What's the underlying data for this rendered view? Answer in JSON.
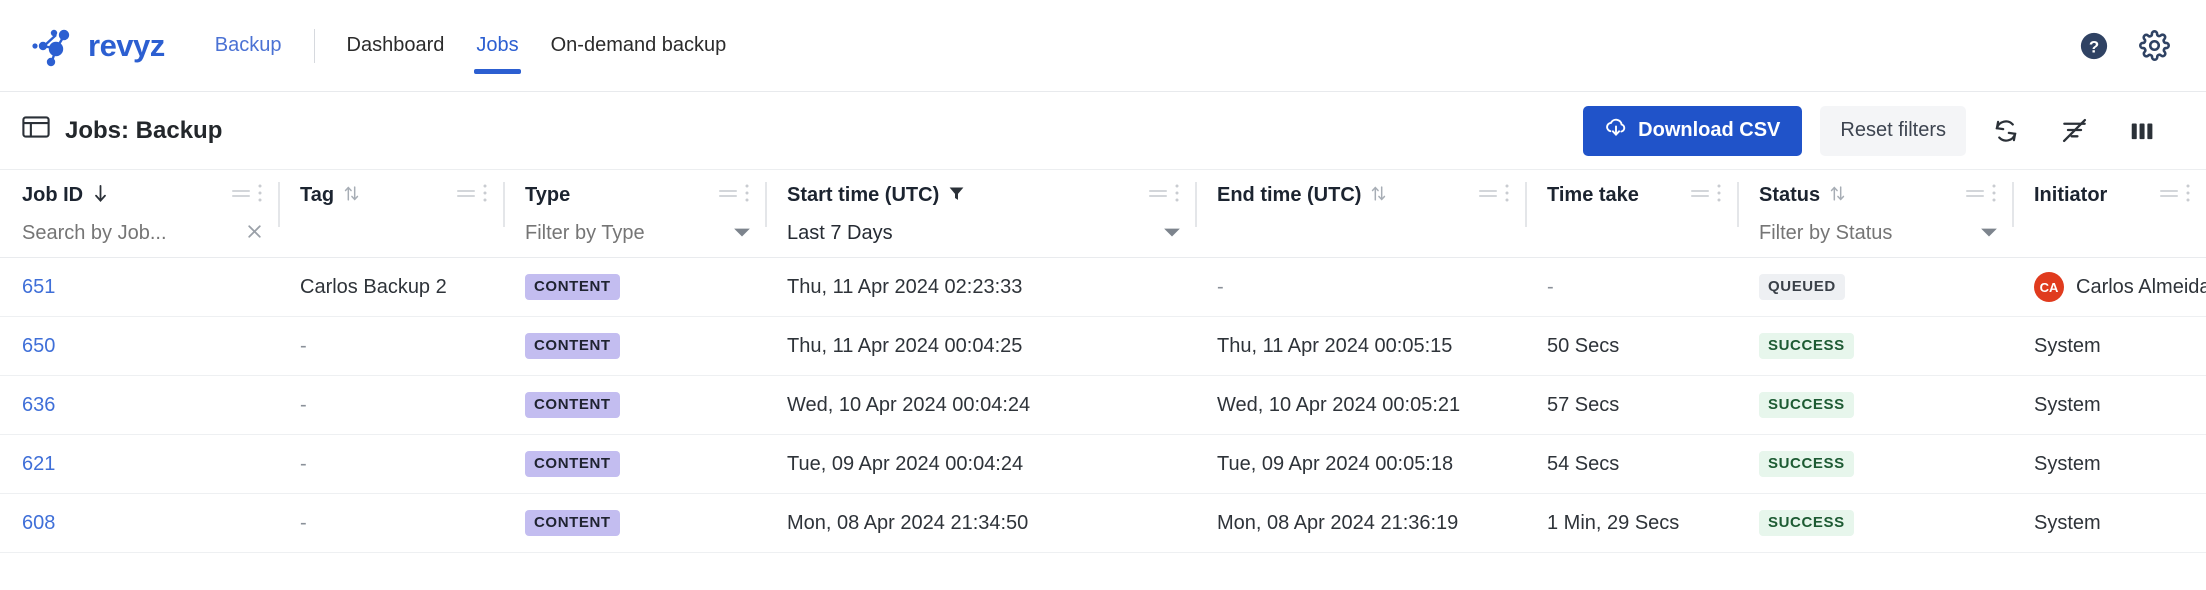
{
  "brand": {
    "name": "revyz",
    "logo_icon": "molecule-node-icon",
    "color": "#2c5fd1"
  },
  "nav": {
    "product_label": "Backup",
    "links": [
      {
        "label": "Dashboard",
        "active": false
      },
      {
        "label": "Jobs",
        "active": true
      },
      {
        "label": "On-demand backup",
        "active": false
      }
    ],
    "right_icons": [
      {
        "name": "help-icon",
        "glyph": "?"
      },
      {
        "name": "settings-gear-icon",
        "glyph": "gear"
      }
    ]
  },
  "toolbar": {
    "title": "Jobs: Backup",
    "title_icon": "table-window-icon",
    "download_csv_label": "Download CSV",
    "download_csv_icon": "cloud-download-icon",
    "reset_filters_label": "Reset filters",
    "icons": [
      {
        "name": "refresh-icon"
      },
      {
        "name": "filter-off-icon"
      },
      {
        "name": "columns-icon"
      }
    ],
    "primary_color": "#2053c9"
  },
  "table": {
    "columns": [
      {
        "label": "Job ID",
        "sort": "desc",
        "filter_kind": "search",
        "filter_value": "",
        "filter_placeholder": "Search by Job..."
      },
      {
        "label": "Tag",
        "sort": "both",
        "filter_kind": "none",
        "filter_value": "",
        "filter_placeholder": ""
      },
      {
        "label": "Type",
        "sort": "none",
        "filter_kind": "select",
        "filter_value": "",
        "filter_placeholder": "Filter by Type"
      },
      {
        "label": "Start time (UTC)",
        "sort": "filtered",
        "filter_kind": "select",
        "filter_value": "Last 7 Days",
        "filter_placeholder": ""
      },
      {
        "label": "End time (UTC)",
        "sort": "both",
        "filter_kind": "none",
        "filter_value": "",
        "filter_placeholder": ""
      },
      {
        "label": "Time take",
        "sort": "none",
        "filter_kind": "none",
        "filter_value": "",
        "filter_placeholder": ""
      },
      {
        "label": "Status",
        "sort": "both",
        "filter_kind": "select",
        "filter_value": "",
        "filter_placeholder": "Filter by Status"
      },
      {
        "label": "Initiator",
        "sort": "none",
        "filter_kind": "none",
        "filter_value": "",
        "filter_placeholder": ""
      }
    ],
    "rows": [
      {
        "job_id": "651",
        "tag": "Carlos Backup 2",
        "type": "CONTENT",
        "start_time": "Thu, 11 Apr 2024 02:23:33",
        "end_time": "-",
        "time_taken": "-",
        "status": "QUEUED",
        "initiator": "Carlos Almeida",
        "initiator_initials": "CA",
        "has_avatar": true
      },
      {
        "job_id": "650",
        "tag": "-",
        "type": "CONTENT",
        "start_time": "Thu, 11 Apr 2024 00:04:25",
        "end_time": "Thu, 11 Apr 2024 00:05:15",
        "time_taken": "50 Secs",
        "status": "SUCCESS",
        "initiator": "System",
        "initiator_initials": "",
        "has_avatar": false
      },
      {
        "job_id": "636",
        "tag": "-",
        "type": "CONTENT",
        "start_time": "Wed, 10 Apr 2024 00:04:24",
        "end_time": "Wed, 10 Apr 2024 00:05:21",
        "time_taken": "57 Secs",
        "status": "SUCCESS",
        "initiator": "System",
        "initiator_initials": "",
        "has_avatar": false
      },
      {
        "job_id": "621",
        "tag": "-",
        "type": "CONTENT",
        "start_time": "Tue, 09 Apr 2024 00:04:24",
        "end_time": "Tue, 09 Apr 2024 00:05:18",
        "time_taken": "54 Secs",
        "status": "SUCCESS",
        "initiator": "System",
        "initiator_initials": "",
        "has_avatar": false
      },
      {
        "job_id": "608",
        "tag": "-",
        "type": "CONTENT",
        "start_time": "Mon, 08 Apr 2024 21:34:50",
        "end_time": "Mon, 08 Apr 2024 21:36:19",
        "time_taken": "1 Min, 29 Secs",
        "status": "SUCCESS",
        "initiator": "System",
        "initiator_initials": "",
        "has_avatar": false
      }
    ]
  },
  "colors": {
    "badge_content": "#c3bdf0",
    "badge_success": "#e7f6ec",
    "badge_queued": "#eef0f3",
    "avatar": "#e03b1e",
    "link": "#3f6fd8"
  }
}
